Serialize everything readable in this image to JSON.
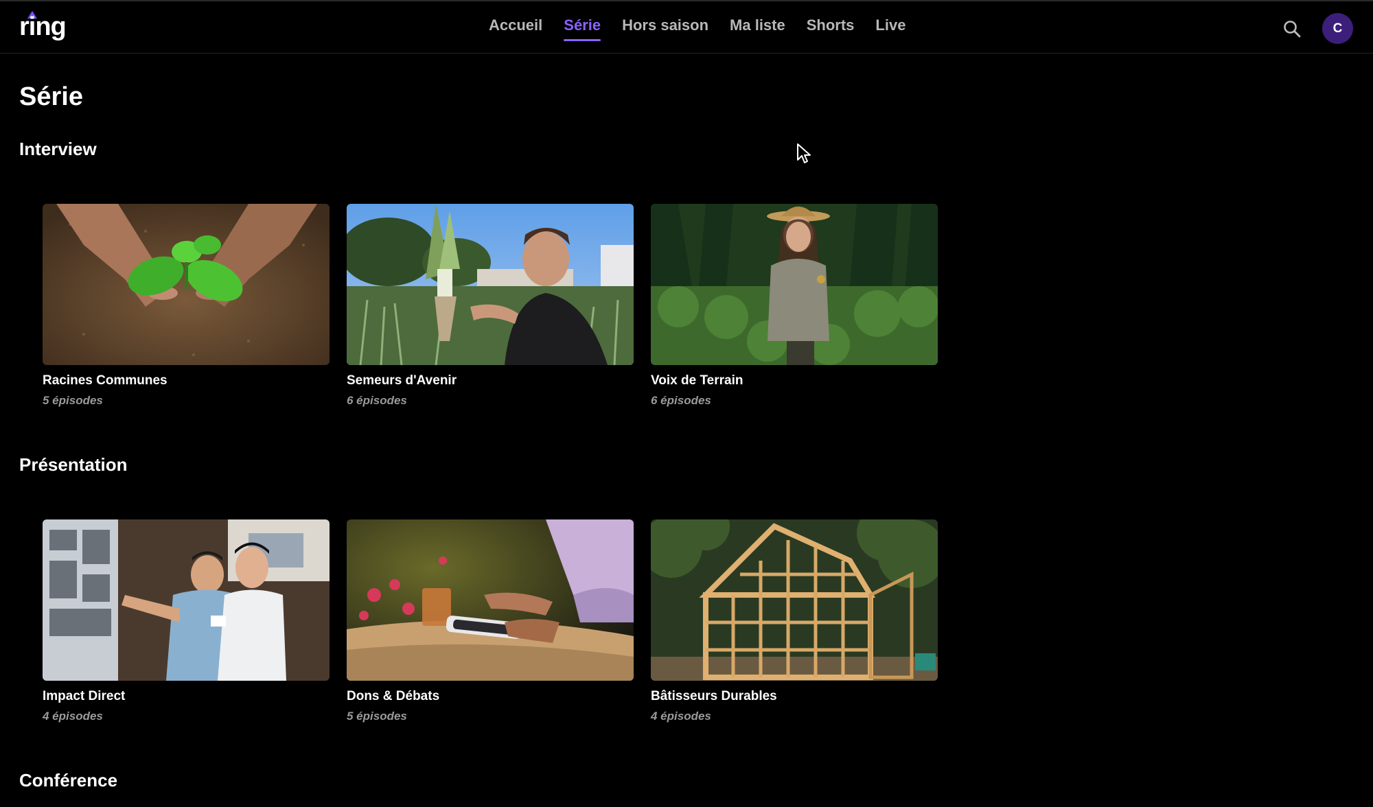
{
  "brand": {
    "logo_text": "ring",
    "accent": "#8a63ff"
  },
  "nav": {
    "items": [
      {
        "label": "Accueil",
        "active": false
      },
      {
        "label": "Série",
        "active": true
      },
      {
        "label": "Hors saison",
        "active": false
      },
      {
        "label": "Ma liste",
        "active": false
      },
      {
        "label": "Shorts",
        "active": false
      },
      {
        "label": "Live",
        "active": false
      }
    ]
  },
  "header": {
    "search_icon": "search-icon",
    "avatar_initial": "C"
  },
  "page": {
    "title": "Série"
  },
  "sections": [
    {
      "title": "Interview",
      "cards": [
        {
          "title": "Racines Communes",
          "episodes": "5 épisodes"
        },
        {
          "title": "Semeurs d'Avenir",
          "episodes": "6 épisodes"
        },
        {
          "title": "Voix de Terrain",
          "episodes": "6 épisodes"
        }
      ]
    },
    {
      "title": "Présentation",
      "cards": [
        {
          "title": "Impact Direct",
          "episodes": "4 épisodes"
        },
        {
          "title": "Dons & Débats",
          "episodes": "5 épisodes"
        },
        {
          "title": "Bâtisseurs Durables",
          "episodes": "4 épisodes"
        }
      ]
    },
    {
      "title": "Conférence",
      "cards": []
    }
  ]
}
